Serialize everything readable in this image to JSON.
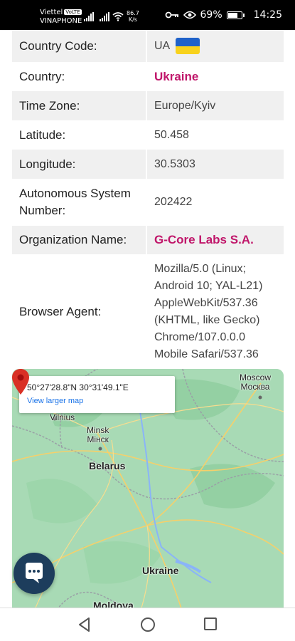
{
  "status_bar": {
    "carrier_1": "Viettel",
    "carrier_1_badge": "VoLTE",
    "carrier_2": "VINAPHONE",
    "net_speed_value": "86.7",
    "net_speed_unit": "K/s",
    "battery_percent": "69%",
    "battery_level": 0.69,
    "time": "14:25"
  },
  "table": {
    "rows": [
      {
        "label": "Country Code:",
        "value": "UA"
      },
      {
        "label": "Country:",
        "value": "Ukraine"
      },
      {
        "label": "Time Zone:",
        "value": "Europe/Kyiv"
      },
      {
        "label": "Latitude:",
        "value": "50.458"
      },
      {
        "label": "Longitude:",
        "value": "30.5303"
      },
      {
        "label": "Autonomous System Number:",
        "value": "202422"
      },
      {
        "label": "Organization Name:",
        "value": "G-Core Labs S.A."
      },
      {
        "label": "Browser Agent:",
        "value": "Mozilla/5.0 (Linux; Android 10; YAL-L21) AppleWebKit/537.36 (KHTML, like Gecko) Chrome/107.0.0.0 Mobile Safari/537.36"
      }
    ]
  },
  "map": {
    "coords": "50°27'28.8\"N 30°31'49.1\"E",
    "view_larger": "View larger map",
    "labels": {
      "moscow": "Moscow",
      "moscow_ru": "Москва",
      "vilnius": "Vilnius",
      "minsk": "Minsk",
      "minsk_be": "Мінск",
      "belarus": "Belarus",
      "ukraine": "Ukraine",
      "moldova": "Moldova"
    }
  },
  "colors": {
    "highlight": "#c0166a",
    "map_green": "#a8dab5",
    "pin_red": "#d93025",
    "chat_bg": "#1d3d5c"
  }
}
